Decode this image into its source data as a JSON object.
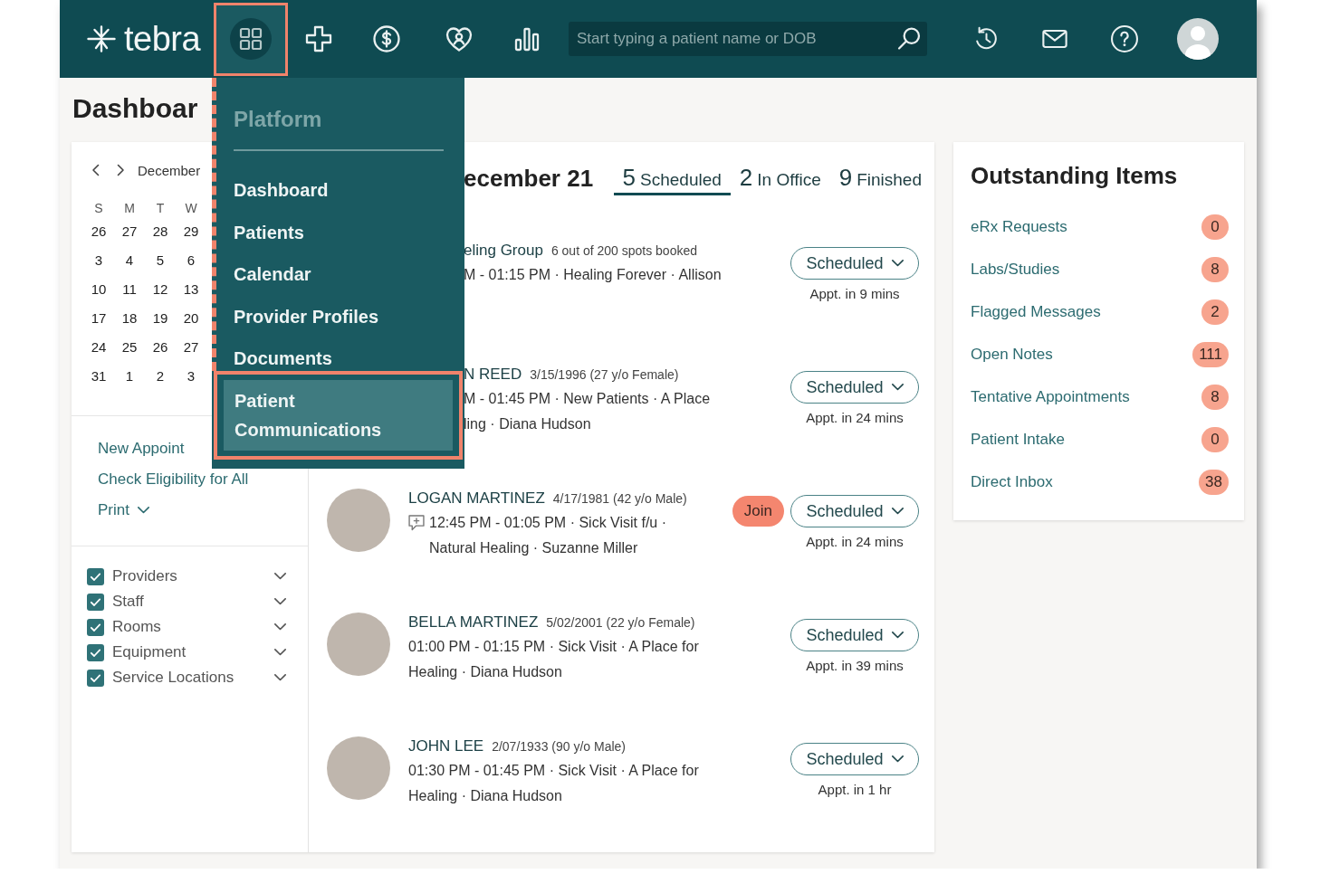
{
  "topbar": {
    "brand": "tebra",
    "nav_buttons": [
      {
        "selected": true
      },
      {
        "selected": false
      },
      {
        "selected": false
      },
      {
        "selected": false
      },
      {
        "selected": false
      }
    ],
    "search": {
      "placeholder": "Start typing a patient name or DOB"
    }
  },
  "platform_menu": {
    "heading": "Platform",
    "items": [
      {
        "label": "Dashboard",
        "selected": false
      },
      {
        "label": "Patients",
        "selected": false
      },
      {
        "label": "Calendar",
        "selected": false
      },
      {
        "label": "Provider Profiles",
        "selected": false
      },
      {
        "label": "Documents",
        "selected": false
      },
      {
        "label": "Patient Communications",
        "selected": true
      }
    ]
  },
  "page_title": "Dashboar",
  "calendar": {
    "month_label": "December",
    "weekdays": [
      "S",
      "M",
      "T",
      "W"
    ],
    "weeks": [
      [
        "26",
        "27",
        "28",
        "29"
      ],
      [
        "3",
        "4",
        "5",
        "6"
      ],
      [
        "10",
        "11",
        "12",
        "13"
      ],
      [
        "17",
        "18",
        "19",
        "20"
      ],
      [
        "24",
        "25",
        "26",
        "27"
      ],
      [
        "31",
        "1",
        "2",
        "3"
      ]
    ]
  },
  "actions": [
    {
      "kind": "link",
      "label": "New Appoint"
    },
    {
      "kind": "link",
      "label": "Check Eligibility for All"
    },
    {
      "kind": "menu",
      "label": "Print"
    }
  ],
  "filters": [
    {
      "label": "Providers",
      "checked": true
    },
    {
      "label": "Staff",
      "checked": true
    },
    {
      "label": "Rooms",
      "checked": true
    },
    {
      "label": "Equipment",
      "checked": true
    },
    {
      "label": "Service Locations",
      "checked": true
    }
  ],
  "schedule": {
    "date_title": "ecember 21",
    "tabs": [
      {
        "count": "5",
        "label": "Scheduled",
        "selected": true
      },
      {
        "count": "2",
        "label": "In Office",
        "selected": false
      },
      {
        "count": "9",
        "label": "Finished",
        "selected": false
      }
    ],
    "appointments": [
      {
        "avatar": false,
        "chat_indicator": false,
        "name": "eling Group",
        "info": "6 out of 200 spots booked",
        "details": "M - 01:15 PM · Healing Forever · Allison",
        "status": "Scheduled",
        "eta": "Appt. in 9 mins"
      },
      {
        "avatar": false,
        "chat_indicator": false,
        "name": "N REED",
        "info": "3/15/1996 (27 y/o Female)",
        "details": "M - 01:45 PM · New Patients · A Place\nling · Diana Hudson",
        "status": "Scheduled",
        "eta": "Appt. in 24 mins"
      },
      {
        "avatar": true,
        "chat_indicator": true,
        "name": "LOGAN MARTINEZ",
        "info": "4/17/1981 (42 y/o Male)",
        "details": "12:45 PM - 01:05 PM · Sick Visit f/u · Natural Healing · Suzanne Miller",
        "join_button": "Join",
        "status": "Scheduled",
        "eta": "Appt. in 24 mins"
      },
      {
        "avatar": true,
        "chat_indicator": false,
        "name": "BELLA MARTINEZ",
        "info": "5/02/2001 (22 y/o Female)",
        "details": "01:00 PM - 01:15 PM · Sick Visit · A Place for Healing · Diana Hudson",
        "status": "Scheduled",
        "eta": "Appt. in 39 mins"
      },
      {
        "avatar": true,
        "chat_indicator": false,
        "name": "JOHN LEE",
        "info": "2/07/1933 (90 y/o Male)",
        "details": "01:30 PM - 01:45 PM · Sick Visit · A Place for Healing · Diana Hudson",
        "status": "Scheduled",
        "eta": "Appt. in 1 hr"
      }
    ]
  },
  "outstanding_items": {
    "title": "Outstanding Items",
    "items": [
      {
        "label": "eRx Requests",
        "count": "0"
      },
      {
        "label": "Labs/Studies",
        "count": "8"
      },
      {
        "label": "Flagged Messages",
        "count": "2"
      },
      {
        "label": "Open Notes",
        "count": "111"
      },
      {
        "label": "Tentative Appointments",
        "count": "8"
      },
      {
        "label": "Patient Intake",
        "count": "0"
      },
      {
        "label": "Direct Inbox",
        "count": "38"
      }
    ]
  }
}
